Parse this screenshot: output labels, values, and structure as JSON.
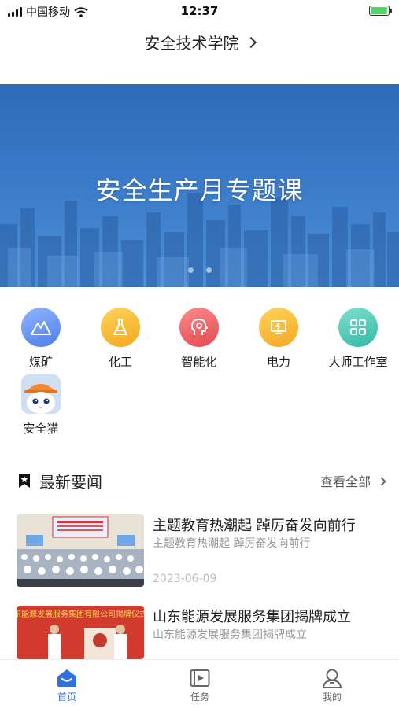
{
  "status_bar": {
    "carrier": "中国移动",
    "time": "12:37",
    "battery_percent": 95
  },
  "header": {
    "title": "安全技术学院"
  },
  "banner": {
    "title": "安全生产月专题课",
    "slide_count": 2
  },
  "categories": [
    {
      "label": "煤矿",
      "icon": "mountain-icon",
      "color": "#5b8ef0"
    },
    {
      "label": "化工",
      "icon": "flask-icon",
      "color": "#f5b72e"
    },
    {
      "label": "智能化",
      "icon": "brain-icon",
      "color": "#e8555a"
    },
    {
      "label": "电力",
      "icon": "lightning-icon",
      "color": "#f6b730"
    },
    {
      "label": "大师工作室",
      "icon": "grid-icon",
      "color": "#46c7b6"
    },
    {
      "label": "安全猫",
      "icon": "cat-mascot-icon",
      "color": "#f08a2a"
    }
  ],
  "news": {
    "title": "最新要闻",
    "see_all": "查看全部",
    "items": [
      {
        "title": "主题教育热潮起 踔厉奋发向前行",
        "subtitle": "主题教育热潮起 踔厉奋发向前行",
        "date": "2023-06-09"
      },
      {
        "title": "山东能源发展服务集团揭牌成立",
        "subtitle": "山东能源发展服务集团揭牌成立",
        "image_text": "东能源发展服务集团有限公司揭牌仪式"
      }
    ]
  },
  "tabs": [
    {
      "label": "首页",
      "icon": "home-icon",
      "active": true
    },
    {
      "label": "任务",
      "icon": "video-task-icon",
      "active": false
    },
    {
      "label": "我的",
      "icon": "profile-icon",
      "active": false
    }
  ],
  "colors": {
    "accent": "#2f6fe0",
    "banner": "#3a7ac8"
  }
}
